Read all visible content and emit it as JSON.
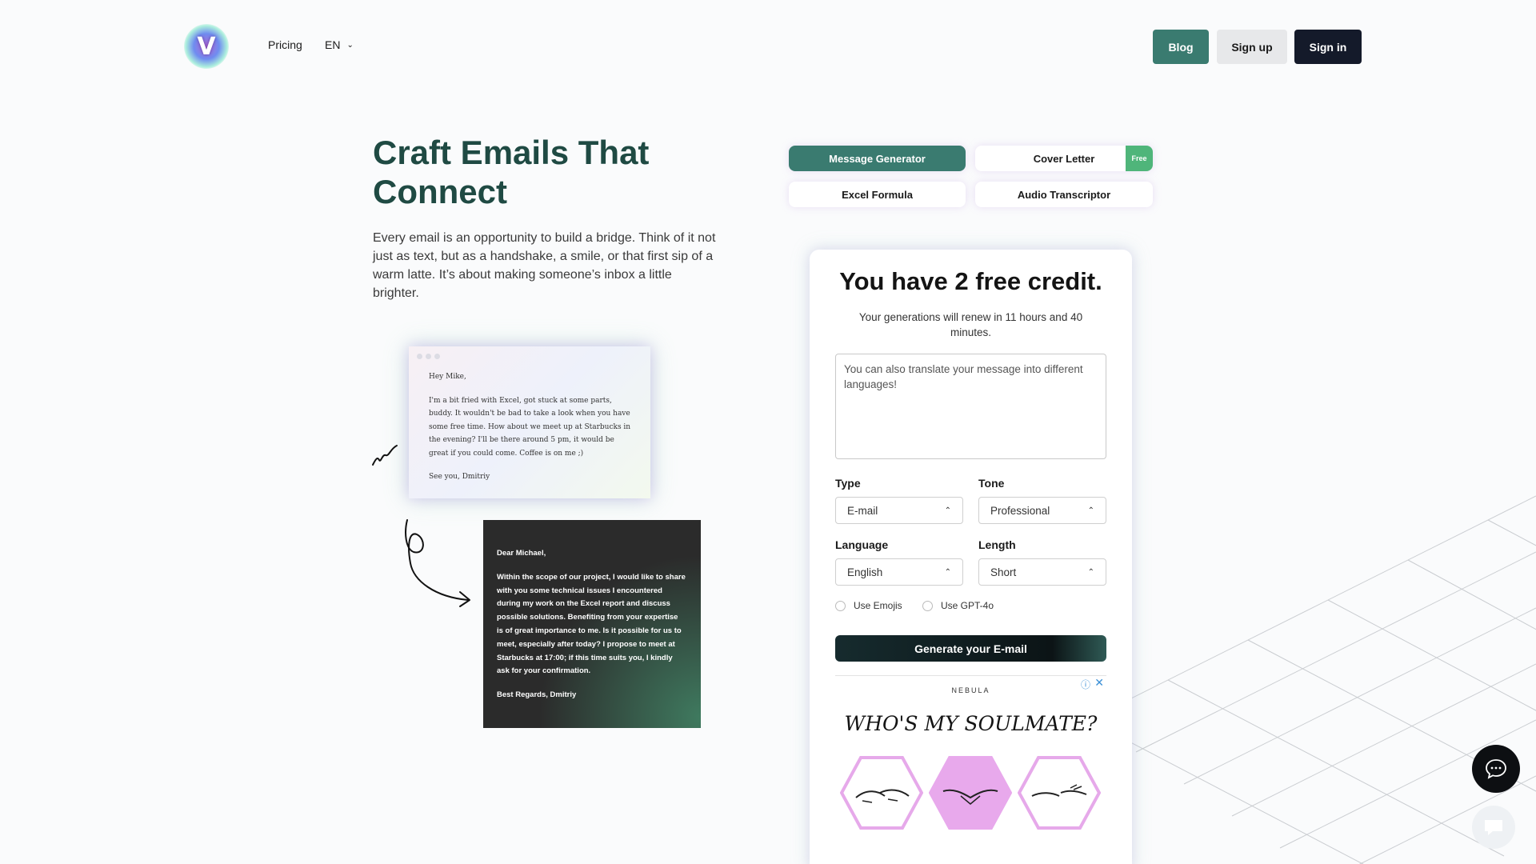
{
  "header": {
    "logo_letter": "V",
    "nav": {
      "pricing": "Pricing",
      "language": "EN"
    },
    "buttons": {
      "blog": "Blog",
      "sign_up": "Sign up",
      "sign_in": "Sign in"
    }
  },
  "hero": {
    "title": "Craft Emails That Connect",
    "description": "Every email is an opportunity to build a bridge. Think of it not just as text, but as a handshake, a smile, or that first sip of a warm latte. It’s about making someone’s inbox a little brighter."
  },
  "examples": {
    "casual": {
      "greeting": "Hey Mike,",
      "body": "I'm a bit fried with Excel, got stuck at some parts, buddy. It wouldn't be bad to take a look when you have some free time. How about we meet up at Starbucks in the evening? I'll be there around 5 pm, it would be great if you could come. Coffee is on me ;)",
      "signoff": "See you, Dmitriy"
    },
    "formal": {
      "greeting": "Dear Michael,",
      "body": "Within the scope of our project, I would like to share with you some technical issues I encountered during my work on the Excel report and discuss possible solutions. Benefiting from your expertise is of great importance to me. Is it possible for us to meet, especially after today? I propose to meet at Starbucks at 17:00; if this time suits you, I kindly ask for your confirmation.",
      "signoff": "Best Regards, Dmitriy"
    }
  },
  "tools": {
    "tabs": [
      {
        "label": "Message Generator",
        "active": true
      },
      {
        "label": "Cover Letter",
        "badge": "Free"
      },
      {
        "label": "Excel Formula"
      },
      {
        "label": "Audio Transcriptor"
      }
    ]
  },
  "generator": {
    "title": "You have 2 free credit.",
    "subtitle": "Your generations will renew in 11 hours and 40 minutes.",
    "message_placeholder": "You can also translate your message into different languages!",
    "type": {
      "label": "Type",
      "value": "E-mail"
    },
    "tone": {
      "label": "Tone",
      "value": "Professional"
    },
    "language": {
      "label": "Language",
      "value": "English"
    },
    "length": {
      "label": "Length",
      "value": "Short"
    },
    "options": {
      "emojis": "Use Emojis",
      "gpt": "Use GPT-4o"
    },
    "generate_label": "Generate your E-mail"
  },
  "ad": {
    "brand": "NEBULA",
    "headline": "WHO'S MY SOULMATE?",
    "info_icon": "info-icon",
    "close_icon": "close-icon"
  },
  "colors": {
    "primary": "#3a7b70",
    "dark": "#141a2a",
    "badge": "#4fb57a",
    "title_green": "#1f4a43"
  }
}
